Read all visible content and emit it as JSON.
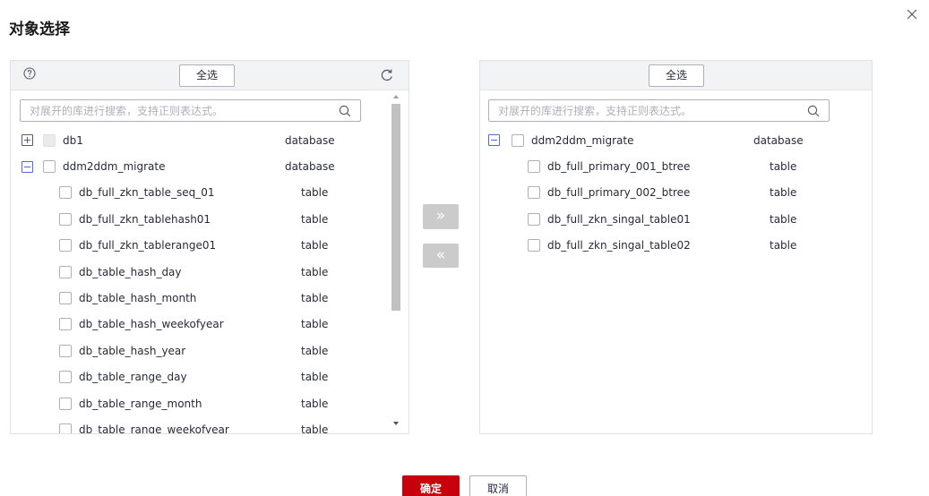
{
  "dialog": {
    "title": "对象选择",
    "close_icon": "close-icon"
  },
  "left_panel": {
    "help_icon": "help-circle-icon",
    "select_all_label": "全选",
    "refresh_icon": "refresh-icon",
    "search": {
      "placeholder": "对展开的库进行搜索，支持正则表达式。",
      "value": "",
      "icon": "search-icon"
    },
    "tree": [
      {
        "name": "db1",
        "type": "database",
        "expanded": false,
        "checked": false,
        "disabled": true
      },
      {
        "name": "ddm2ddm_migrate",
        "type": "database",
        "expanded": true,
        "checked": false,
        "disabled": false,
        "children": [
          {
            "name": "db_full_zkn_table_seq_01",
            "type": "table",
            "checked": false
          },
          {
            "name": "db_full_zkn_tablehash01",
            "type": "table",
            "checked": false
          },
          {
            "name": "db_full_zkn_tablerange01",
            "type": "table",
            "checked": false
          },
          {
            "name": "db_table_hash_day",
            "type": "table",
            "checked": false
          },
          {
            "name": "db_table_hash_month",
            "type": "table",
            "checked": false
          },
          {
            "name": "db_table_hash_weekofyear",
            "type": "table",
            "checked": false
          },
          {
            "name": "db_table_hash_year",
            "type": "table",
            "checked": false
          },
          {
            "name": "db_table_range_day",
            "type": "table",
            "checked": false
          },
          {
            "name": "db_table_range_month",
            "type": "table",
            "checked": false
          },
          {
            "name": "db_table_range_weekofyear",
            "type": "table",
            "checked": false
          }
        ]
      }
    ]
  },
  "transfer": {
    "move_right_label": "»",
    "move_left_label": "«"
  },
  "right_panel": {
    "select_all_label": "全选",
    "search": {
      "placeholder": "对展开的库进行搜索，支持正则表达式。",
      "value": "",
      "icon": "search-icon"
    },
    "tree": [
      {
        "name": "ddm2ddm_migrate",
        "type": "database",
        "expanded": true,
        "checked": false,
        "disabled": false,
        "children": [
          {
            "name": "db_full_primary_001_btree",
            "type": "table",
            "checked": false
          },
          {
            "name": "db_full_primary_002_btree",
            "type": "table",
            "checked": false
          },
          {
            "name": "db_full_zkn_singal_table01",
            "type": "table",
            "checked": false
          },
          {
            "name": "db_full_zkn_singal_table02",
            "type": "table",
            "checked": false
          }
        ]
      }
    ]
  },
  "footer": {
    "confirm_label": "确定",
    "cancel_label": "取消"
  },
  "colors": {
    "primary": "#c7000b",
    "accent": "#526ecc",
    "transfer_button_bg": "#cbcbcb",
    "border": "#dfe1e6",
    "header_bg": "#f2f3f5"
  }
}
